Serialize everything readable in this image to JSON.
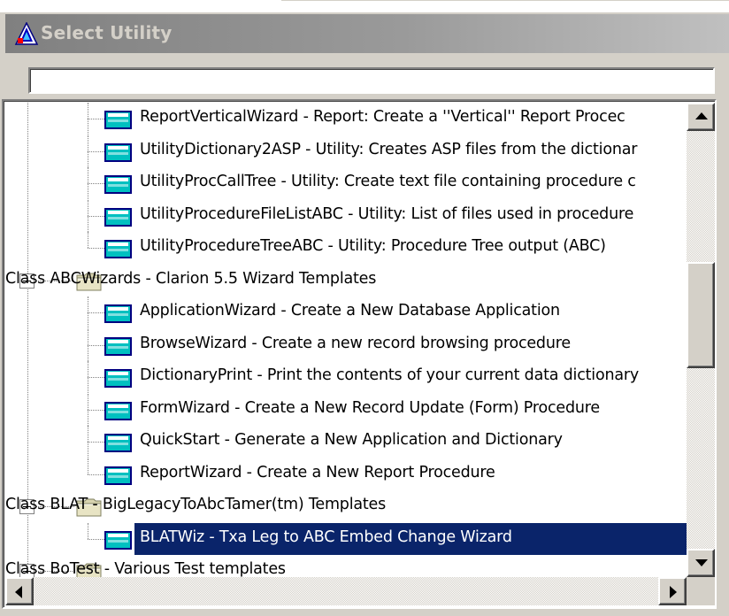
{
  "window": {
    "title": "Select Utility",
    "title_icon": "clarion-utility-icon"
  },
  "filter": {
    "value": "",
    "placeholder": ""
  },
  "tree": {
    "items": [
      {
        "kind": "child",
        "label": "ReportVerticalWizard - Report: Create a ''Vertical'' Report Procec",
        "icon": "template-icon"
      },
      {
        "kind": "child",
        "label": "UtilityDictionary2ASP - Utility: Creates ASP files from the dictionar",
        "icon": "template-icon"
      },
      {
        "kind": "child",
        "label": "UtilityProcCallTree - Utility: Create text file containing procedure c",
        "icon": "template-icon"
      },
      {
        "kind": "child",
        "label": "UtilityProcedureFileListABC - Utility:  List of files used in procedure",
        "icon": "template-icon"
      },
      {
        "kind": "child",
        "label": "UtilityProcedureTreeABC - Utility:  Procedure Tree output (ABC)",
        "icon": "template-icon",
        "last": true
      },
      {
        "kind": "class",
        "label": "Class ABCWizards - Clarion 5.5 Wizard Templates",
        "icon": "folder-icon",
        "expanded": true
      },
      {
        "kind": "child",
        "label": "ApplicationWizard - Create a New Database Application",
        "icon": "template-icon"
      },
      {
        "kind": "child",
        "label": "BrowseWizard - Create a new record browsing procedure",
        "icon": "template-icon"
      },
      {
        "kind": "child",
        "label": "DictionaryPrint - Print the contents of your current data dictionary",
        "icon": "template-icon"
      },
      {
        "kind": "child",
        "label": "FormWizard - Create a New Record Update (Form) Procedure",
        "icon": "template-icon"
      },
      {
        "kind": "child",
        "label": "QuickStart - Generate a New Application and Dictionary",
        "icon": "template-icon"
      },
      {
        "kind": "child",
        "label": "ReportWizard - Create a New Report Procedure",
        "icon": "template-icon",
        "last": true
      },
      {
        "kind": "class",
        "label": "Class BLAT - BigLegacyToAbcTamer(tm) Templates",
        "icon": "folder-icon",
        "expanded": true
      },
      {
        "kind": "child",
        "label": "BLATWiz - Txa Leg to ABC Embed Change Wizard",
        "icon": "template-icon",
        "selected": true,
        "last": true
      },
      {
        "kind": "class",
        "label": "Class BoTest - Various Test templates",
        "icon": "folder-icon",
        "expanded": true
      }
    ]
  },
  "scrollbars": {
    "vertical": {
      "up_icon": "scroll-up-arrow-icon",
      "down_icon": "scroll-down-arrow-icon",
      "position": 0.42,
      "visible_fraction": 0.25
    },
    "horizontal": {
      "left_icon": "scroll-left-arrow-icon",
      "right_icon": "scroll-right-arrow-icon",
      "position": 0.0
    }
  },
  "colors": {
    "face": "#d4d0c8",
    "selection": "#0a246a",
    "titlebar_inactive": "#808080"
  }
}
